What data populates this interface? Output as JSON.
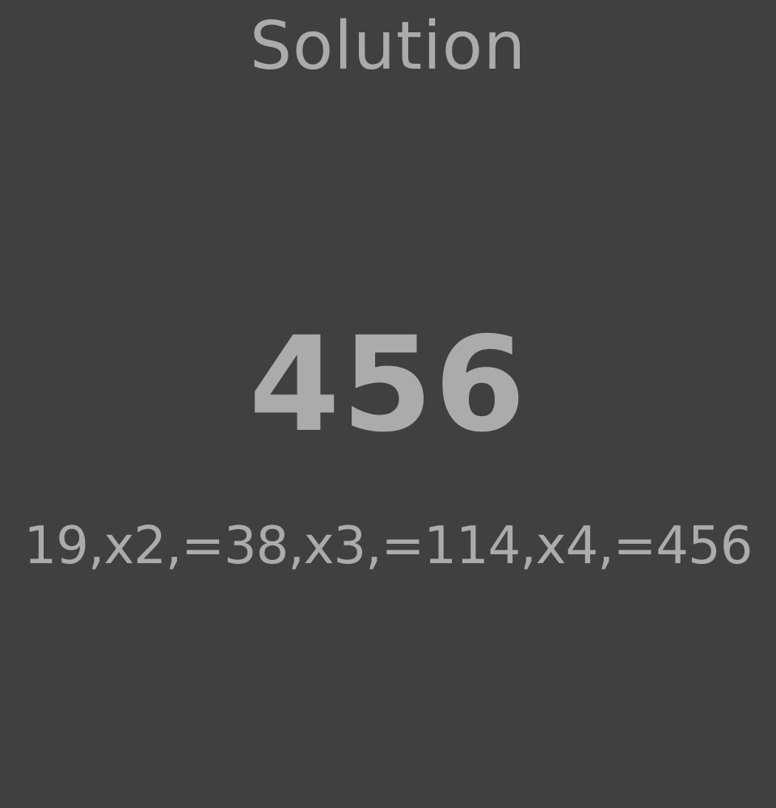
{
  "screen": {
    "title": "Solution",
    "answer": "456",
    "steps": "19,x2,=38,x3,=114,x4,=456"
  },
  "colors": {
    "background": "#404040",
    "text": "#ababab"
  }
}
